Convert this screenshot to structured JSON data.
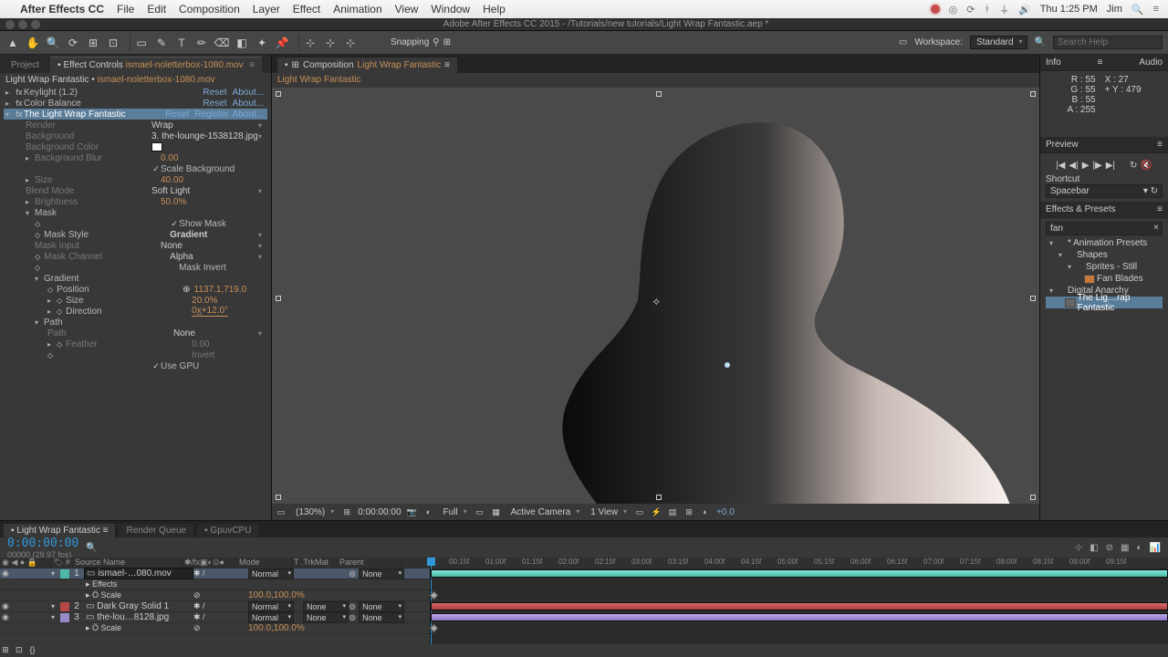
{
  "mac": {
    "app": "After Effects CC",
    "menus": [
      "File",
      "Edit",
      "Composition",
      "Layer",
      "Effect",
      "Animation",
      "View",
      "Window",
      "Help"
    ],
    "clock": "Thu 1:25 PM",
    "user": "Jim"
  },
  "docTitle": "Adobe After Effects CC 2015 - /Tutorials/new tutorials/Light Wrap Fantastic.aep *",
  "toolbar": {
    "snapping": "Snapping",
    "workspaceLabel": "Workspace:",
    "workspace": "Standard",
    "searchPlaceholder": "Search Help"
  },
  "effectControls": {
    "tabProject": "Project",
    "tabLabel": "Effect Controls",
    "clip": "ismael-noletterbox-1080.mov",
    "headerComp": "Light Wrap Fantastic",
    "headerLayer": "ismael-noletterbox-1080.mov",
    "fx": [
      {
        "name": "Keylight (1.2)",
        "reset": "Reset",
        "about": "About..."
      },
      {
        "name": "Color Balance",
        "reset": "Reset",
        "about": "About..."
      },
      {
        "name": "The Light Wrap Fantastic",
        "reset": "Reset",
        "register": "Register",
        "about": "About...",
        "selected": true
      }
    ],
    "params": {
      "render": "Render",
      "background": "Background",
      "wrap": "Wrap",
      "bgSource": "3. the-lounge-1538128.jpg",
      "bgColor": "Background Color",
      "bgBlur": "Background Blur",
      "bgBlurVal": "0.00",
      "scaleBg": "Scale Background",
      "size": "Size",
      "sizeVal": "40.00",
      "blendMode": "Blend Mode",
      "blendModeVal": "Soft Light",
      "brightness": "Brightness",
      "brightnessVal": "50.0%",
      "mask": "Mask",
      "showMask": "Show Mask",
      "maskStyle": "Mask Style",
      "maskStyleVal": "Gradient",
      "maskInput": "Mask Input",
      "maskInputVal": "None",
      "maskChannel": "Mask Channel",
      "maskChannelVal": "Alpha",
      "maskInvert": "Mask Invert",
      "gradient": "Gradient",
      "position": "Position",
      "positionVal": "1137.1,719.0",
      "gsize": "Size",
      "gsizeVal": "20.0%",
      "direction": "Direction",
      "directionVal": "0x̲+12.0°",
      "path": "Path",
      "pathSrc": "Path",
      "pathVal": "None",
      "feather": "Feather",
      "featherVal": "0.00",
      "invert": "Invert",
      "useGPU": "Use GPU"
    }
  },
  "viewport": {
    "tabLabel": "Composition",
    "compName": "Light Wrap Fantastic",
    "subbar": "Light Wrap Fantastic",
    "footer": {
      "mag": "(130%)",
      "tc": "0:00:00:00",
      "res": "Full",
      "camera": "Active Camera",
      "views": "1 View",
      "exposure": "+0.0"
    }
  },
  "right": {
    "info": {
      "title": "Info",
      "audio": "Audio",
      "R": "R : 55",
      "G": "G : 55",
      "B": "B : 55",
      "A": "A : 255",
      "X": "X : 27",
      "Y": "Y : 479",
      "plus": "+"
    },
    "preview": {
      "title": "Preview",
      "shortcutLbl": "Shortcut",
      "shortcut": "Spacebar"
    },
    "ep": {
      "title": "Effects & Presets",
      "search": "fan",
      "tree": [
        {
          "l": 0,
          "open": true,
          "label": "* Animation Presets"
        },
        {
          "l": 1,
          "open": true,
          "label": "Shapes"
        },
        {
          "l": 2,
          "open": true,
          "label": "Sprites - Still"
        },
        {
          "l": 3,
          "leaf": true,
          "label": "Fan Blades"
        },
        {
          "l": 0,
          "open": true,
          "label": "Digital Anarchy"
        },
        {
          "l": 1,
          "leaf": true,
          "selected": true,
          "label": "The Lig…rap Fantastic"
        }
      ]
    }
  },
  "timeline": {
    "tabs": [
      "Light Wrap Fantastic",
      "Render Queue",
      "GpuvCPU"
    ],
    "timecode": "0:00:00:00",
    "subcode": "00000 (29.97 fps)",
    "cols": {
      "src": "Source Name",
      "mode": "Mode",
      "trk": "T .TrkMat",
      "parent": "Parent"
    },
    "ruler": [
      "00:15f",
      "01:00f",
      "01:15f",
      "02:00f",
      "02:15f",
      "03:00f",
      "03:15f",
      "04:00f",
      "04:15f",
      "05:00f",
      "05:15f",
      "06:00f",
      "06:15f",
      "07:00f",
      "07:15f",
      "08:00f",
      "08:15f",
      "09:00f",
      "09:15f"
    ],
    "layers": [
      {
        "n": "1",
        "name": "ismael-…080.mov",
        "mode": "Normal",
        "trk": "",
        "parent": "None",
        "sw": "teal",
        "selected": true,
        "children": [
          {
            "label": "Effects"
          },
          {
            "label": "Scale",
            "val": "100.0,100.0%"
          }
        ]
      },
      {
        "n": "2",
        "name": "Dark Gray Solid 1",
        "mode": "Normal",
        "trk": "None",
        "parent": "None",
        "sw": "red"
      },
      {
        "n": "3",
        "name": "the-lou…8128.jpg",
        "mode": "Normal",
        "trk": "None",
        "parent": "None",
        "sw": "lav",
        "children": [
          {
            "label": "Scale",
            "val": "100.0,100.0%"
          }
        ]
      }
    ]
  }
}
